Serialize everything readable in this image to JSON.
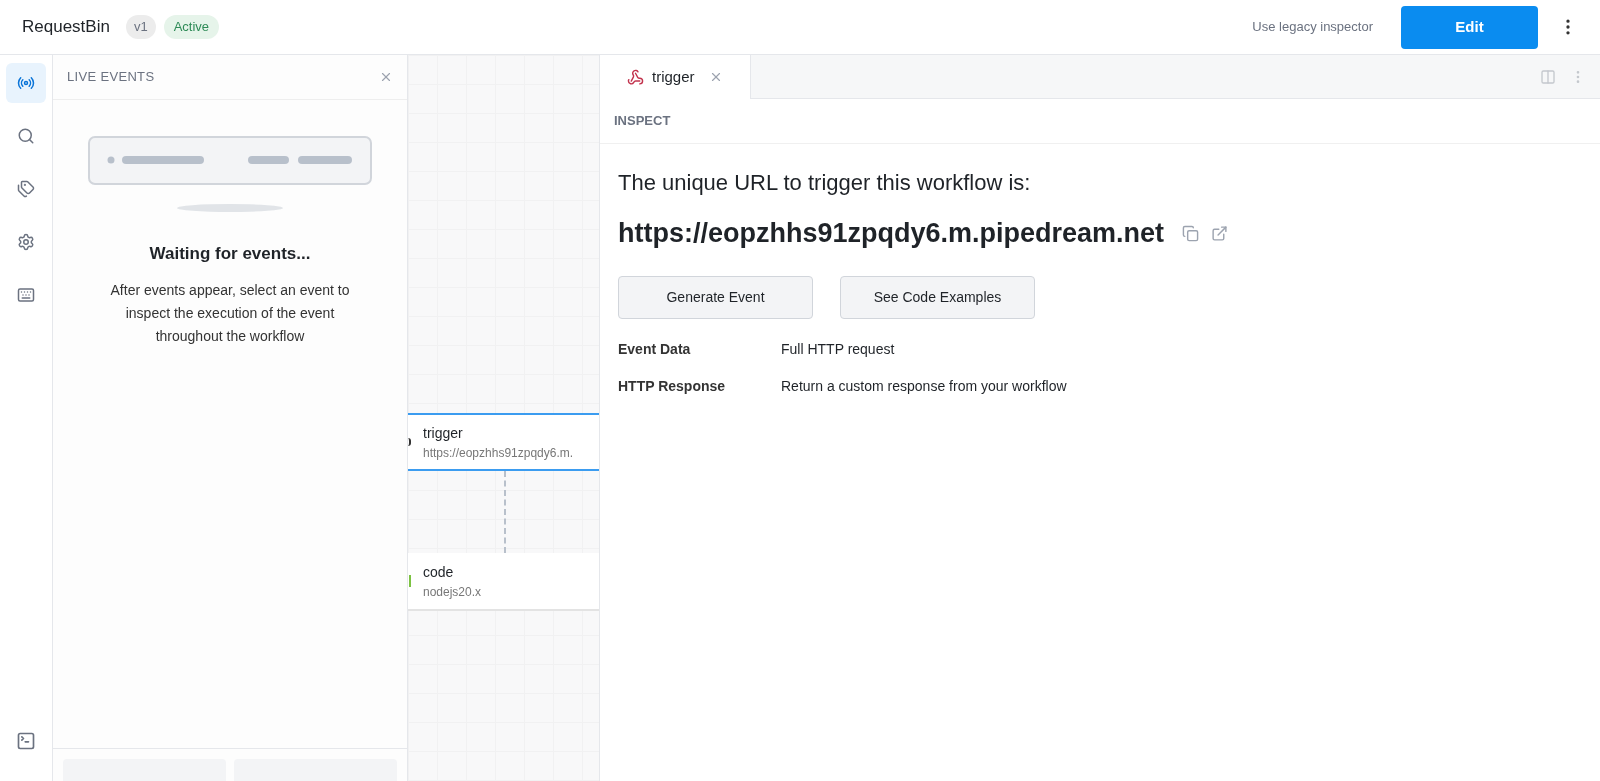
{
  "header": {
    "title": "RequestBin",
    "version": "v1",
    "status": "Active",
    "legacy_link": "Use legacy inspector",
    "edit_button": "Edit"
  },
  "rail": {
    "items": [
      {
        "kind": "live",
        "selected": true
      },
      {
        "kind": "search",
        "selected": false
      },
      {
        "kind": "tags",
        "selected": false
      },
      {
        "kind": "settings",
        "selected": false
      },
      {
        "kind": "keyboard",
        "selected": false
      }
    ]
  },
  "live_events": {
    "title": "LIVE EVENTS",
    "heading": "Waiting for events...",
    "message": "After events appear, select an event to inspect the execution of the event throughout the workflow"
  },
  "canvas": {
    "nodes": [
      {
        "kind": "trigger",
        "name": "trigger",
        "detail": "https://eopzhhs91zpqdy6.m.",
        "selected": true
      },
      {
        "kind": "code",
        "name": "code",
        "detail": "nodejs20.x",
        "selected": false
      }
    ]
  },
  "tabs": [
    {
      "label": "trigger",
      "selected": true
    }
  ],
  "inspect": {
    "section": "INSPECT",
    "intro": "The unique URL to trigger this workflow is:",
    "url": "https://eopzhhs91zpqdy6.m.pipedream.net",
    "buttons": [
      "Generate Event",
      "See Code Examples"
    ],
    "properties": [
      {
        "label": "Event Data",
        "value": "Full HTTP request"
      },
      {
        "label": "HTTP Response",
        "value": "Return a custom response from your workflow"
      }
    ]
  }
}
